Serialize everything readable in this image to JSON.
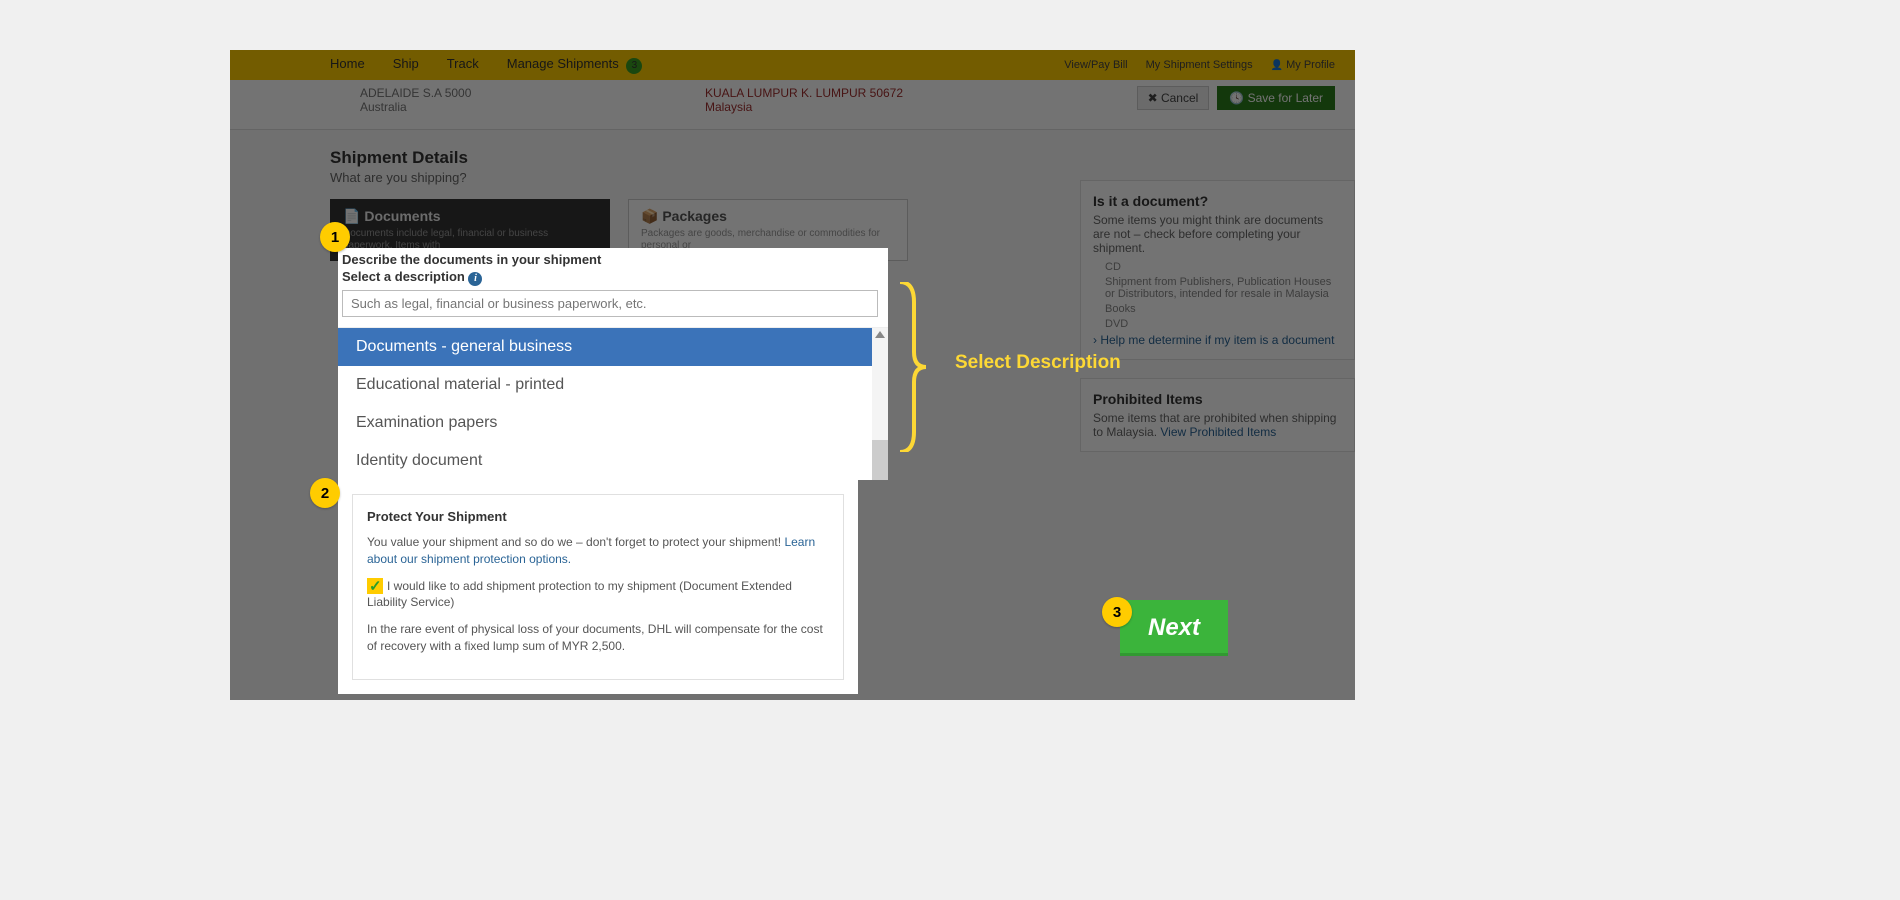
{
  "nav": {
    "home": "Home",
    "ship": "Ship",
    "track": "Track",
    "manage": "Manage Shipments",
    "manage_badge": "3",
    "view_pay": "View/Pay Bill",
    "settings": "My Shipment Settings",
    "profile": "My Profile"
  },
  "address": {
    "from_line1": "ADELAIDE S.A 5000",
    "from_line2": "Australia",
    "to_line1": "KUALA LUMPUR K. LUMPUR 50672",
    "to_line2": "Malaysia",
    "cancel": "Cancel",
    "save": "Save for Later"
  },
  "section": {
    "title": "Shipment Details",
    "subtitle": "What are you shipping?"
  },
  "tabs": {
    "documents": "Documents",
    "documents_desc": "Documents include legal, financial or business paperwork. Items with",
    "packages": "Packages",
    "packages_desc": "Packages are goods, merchandise or commodities for personal or"
  },
  "dropdown": {
    "label1": "Describe the documents in your shipment",
    "label2": "Select a description",
    "placeholder": "Such as legal, financial or business paperwork, etc.",
    "opt1": "Documents - general business",
    "opt2": "Educational material - printed",
    "opt3": "Examination papers",
    "opt4": "Identity document"
  },
  "annotation": "Select Description",
  "sidepanels": {
    "doc_title": "Is it a document?",
    "doc_body": "Some items you might think are documents are not – check before completing your shipment.",
    "doc_li1": "CD",
    "doc_li2": "Shipment from Publishers, Publication Houses or Distributors, intended for resale in Malaysia",
    "doc_li3": "Books",
    "doc_li4": "DVD",
    "doc_link": "Help me determine if my item is a document",
    "proh_title": "Prohibited Items",
    "proh_body": "Some items that are prohibited when shipping to Malaysia. ",
    "proh_link": "View Prohibited Items"
  },
  "protect": {
    "title": "Protect Your Shipment",
    "body1a": "You value your shipment and so do we – don't forget to protect your shipment! ",
    "body1_link": "Learn about our shipment protection options.",
    "checkbox_label": "I would like to add shipment protection to my shipment (Document Extended Liability Service)",
    "body2": "In the rare event of physical loss of your documents, DHL will compensate for the cost of recovery with a fixed lump sum of MYR 2,500."
  },
  "next_btn": "Next",
  "callouts": {
    "n1": "1",
    "n2": "2",
    "n3": "3"
  }
}
